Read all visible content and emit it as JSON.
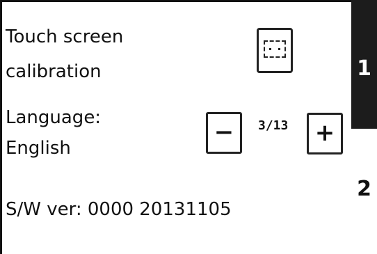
{
  "settings": {
    "touch_label_line1": "Touch screen",
    "touch_label_line2": "calibration",
    "language_label": "Language:",
    "language_value": "English",
    "language_index": "3/13",
    "minus_label": "−",
    "plus_label": "+",
    "software_version": "S/W ver: 0000 20131105"
  },
  "tabs": [
    {
      "label": "1",
      "selected": true
    },
    {
      "label": "2",
      "selected": false
    }
  ],
  "icons": {
    "calibration_button": "touch-calibration-icon"
  }
}
